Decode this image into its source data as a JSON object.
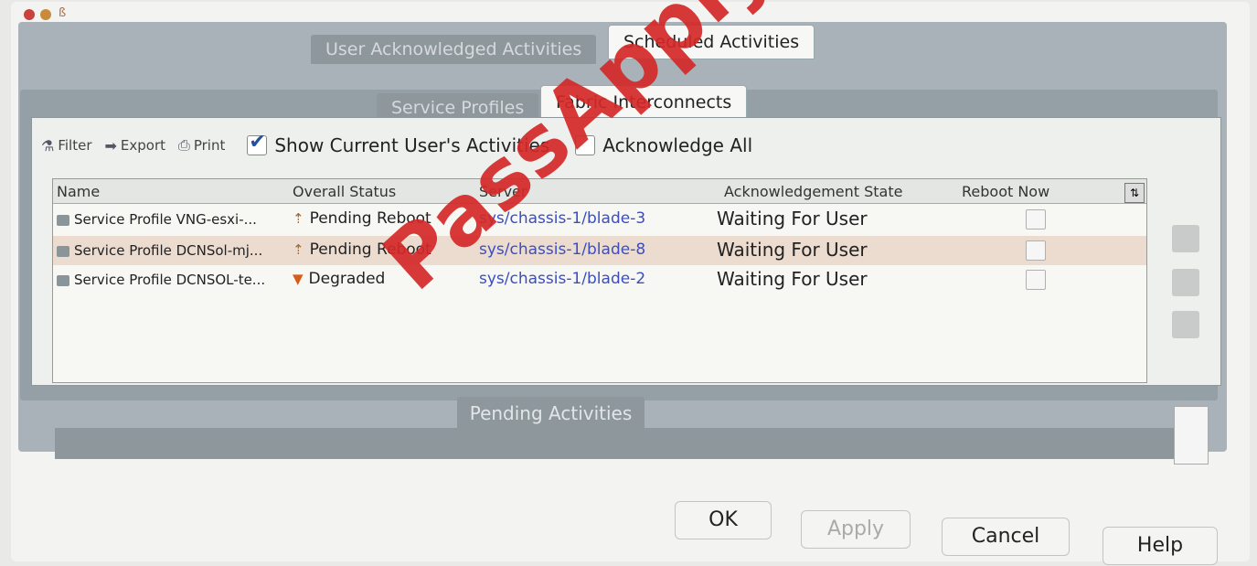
{
  "window": {
    "title_glyph": "ß"
  },
  "top_tabs": [
    {
      "label": "User Acknowledged Activities",
      "active": true
    },
    {
      "label": "Scheduled Activities",
      "active": false
    }
  ],
  "sub_tabs": [
    {
      "label": "Service Profiles",
      "active": true
    },
    {
      "label": "Fabric Interconnects",
      "active": false
    }
  ],
  "toolbar": {
    "filter": "Filter",
    "export": "Export",
    "print": "Print",
    "show_current": "Show Current User's Activities",
    "show_current_checked": true,
    "acknowledge_all": "Acknowledge All",
    "acknowledge_all_checked": false
  },
  "table": {
    "columns": [
      "Name",
      "Overall Status",
      "Server",
      "Acknowledgement State",
      "Reboot Now"
    ],
    "rows": [
      {
        "name": "Service Profile VNG-esxi-...",
        "status": "Pending Reboot",
        "server": "sys/chassis-1/blade-3",
        "ack": "Waiting For User"
      },
      {
        "name": "Service Profile DCNSol-mj...",
        "status": "Pending Reboot",
        "server": "sys/chassis-1/blade-8",
        "ack": "Waiting For User"
      },
      {
        "name": "Service Profile DCNSOL-te...",
        "status": "Degraded",
        "server": "sys/chassis-1/blade-2",
        "ack": "Waiting For User"
      }
    ]
  },
  "pending_tab": "Pending Activities",
  "buttons": {
    "ok": "OK",
    "apply": "Apply",
    "cancel": "Cancel",
    "help": "Help"
  },
  "watermark": "PassApply.com",
  "colors": {
    "accent": "#3a4ec2",
    "watermark": "#d42828",
    "degraded": "#d95b1a"
  }
}
